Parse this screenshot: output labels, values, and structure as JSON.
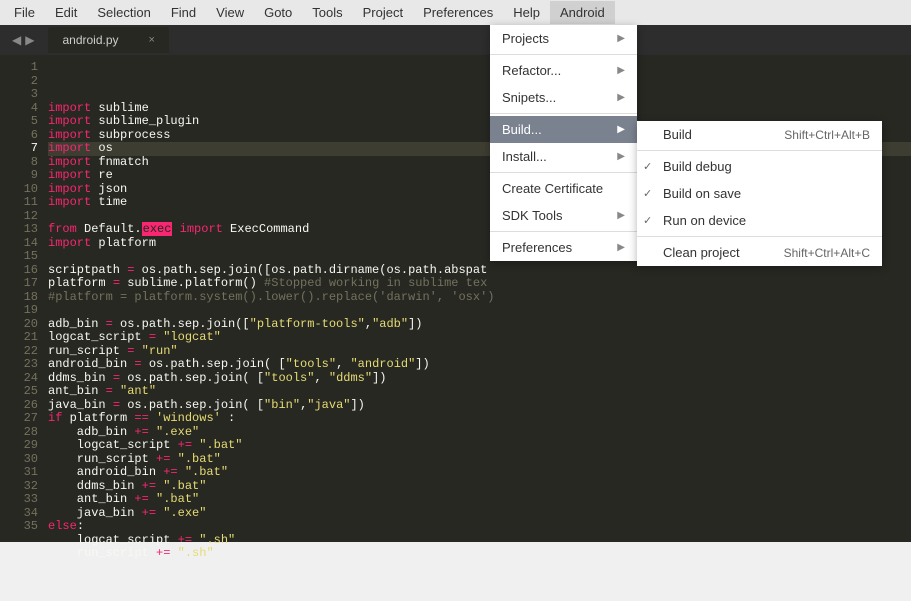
{
  "menubar": [
    "File",
    "Edit",
    "Selection",
    "Find",
    "View",
    "Goto",
    "Tools",
    "Project",
    "Preferences",
    "Help",
    "Android"
  ],
  "active_menu": "Android",
  "tab": {
    "name": "android.py"
  },
  "active_line": 7,
  "gutter_start": 1,
  "gutter_end": 35,
  "dropdown_main": [
    {
      "label": "Projects",
      "arrow": true
    },
    {
      "sep": true
    },
    {
      "label": "Refactor...",
      "arrow": true
    },
    {
      "label": "Snipets...",
      "arrow": true
    },
    {
      "sep": true
    },
    {
      "label": "Build...",
      "arrow": true,
      "hover": true
    },
    {
      "label": "Install...",
      "arrow": true
    },
    {
      "sep": true
    },
    {
      "label": "Create Certificate"
    },
    {
      "label": "SDK Tools",
      "arrow": true
    },
    {
      "sep": true
    },
    {
      "label": "Preferences",
      "arrow": true
    }
  ],
  "submenu": [
    {
      "label": "Build",
      "shortcut": "Shift+Ctrl+Alt+B"
    },
    {
      "sep": true
    },
    {
      "label": "Build debug",
      "check": true
    },
    {
      "label": "Build on save",
      "check": true
    },
    {
      "label": "Run on device",
      "check": true
    },
    {
      "sep": true
    },
    {
      "label": "Clean project",
      "shortcut": "Shift+Ctrl+Alt+C"
    }
  ],
  "code": [
    [
      [
        "kw",
        "import"
      ],
      [
        "id",
        " sublime"
      ]
    ],
    [
      [
        "kw",
        "import"
      ],
      [
        "id",
        " sublime_plugin"
      ]
    ],
    [
      [
        "kw",
        "import"
      ],
      [
        "id",
        " subprocess"
      ]
    ],
    [
      [
        "kw",
        "import"
      ],
      [
        "id",
        " os"
      ]
    ],
    [
      [
        "kw",
        "import"
      ],
      [
        "id",
        " fnmatch"
      ]
    ],
    [
      [
        "kw",
        "import"
      ],
      [
        "id",
        " re"
      ]
    ],
    [
      [
        "kw",
        "import"
      ],
      [
        "id",
        " json"
      ]
    ],
    [
      [
        "kw",
        "import"
      ],
      [
        "id",
        " time"
      ]
    ],
    [],
    [
      [
        "kw",
        "from"
      ],
      [
        "id",
        " Default."
      ],
      [
        "hl-exec",
        "exec"
      ],
      [
        "id",
        " "
      ],
      [
        "kw",
        "import"
      ],
      [
        "id",
        " ExecCommand"
      ]
    ],
    [
      [
        "kw",
        "import"
      ],
      [
        "id",
        " platform"
      ]
    ],
    [],
    [
      [
        "id",
        "scriptpath "
      ],
      [
        "kw",
        "="
      ],
      [
        "id",
        " os.path.sep.join([os.path.dirname(os.path.abspat"
      ]
    ],
    [
      [
        "id",
        "platform "
      ],
      [
        "kw",
        "="
      ],
      [
        "id",
        " sublime.platform() "
      ],
      [
        "cm",
        "#Stopped working in sublime tex"
      ]
    ],
    [
      [
        "cm",
        "#platform = platform.system().lower().replace('darwin', 'osx')"
      ]
    ],
    [],
    [
      [
        "id",
        "adb_bin "
      ],
      [
        "kw",
        "="
      ],
      [
        "id",
        " os.path.sep.join(["
      ],
      [
        "st",
        "\"platform-tools\""
      ],
      [
        "id",
        ","
      ],
      [
        "st",
        "\"adb\""
      ],
      [
        "id",
        "])"
      ]
    ],
    [
      [
        "id",
        "logcat_script "
      ],
      [
        "kw",
        "="
      ],
      [
        "id",
        " "
      ],
      [
        "st",
        "\"logcat\""
      ]
    ],
    [
      [
        "id",
        "run_script "
      ],
      [
        "kw",
        "="
      ],
      [
        "id",
        " "
      ],
      [
        "st",
        "\"run\""
      ]
    ],
    [
      [
        "id",
        "android_bin "
      ],
      [
        "kw",
        "="
      ],
      [
        "id",
        " os.path.sep.join( ["
      ],
      [
        "st",
        "\"tools\""
      ],
      [
        "id",
        ", "
      ],
      [
        "st",
        "\"android\""
      ],
      [
        "id",
        "])"
      ]
    ],
    [
      [
        "id",
        "ddms_bin "
      ],
      [
        "kw",
        "="
      ],
      [
        "id",
        " os.path.sep.join( ["
      ],
      [
        "st",
        "\"tools\""
      ],
      [
        "id",
        ", "
      ],
      [
        "st",
        "\"ddms\""
      ],
      [
        "id",
        "])"
      ]
    ],
    [
      [
        "id",
        "ant_bin "
      ],
      [
        "kw",
        "="
      ],
      [
        "id",
        " "
      ],
      [
        "st",
        "\"ant\""
      ]
    ],
    [
      [
        "id",
        "java_bin "
      ],
      [
        "kw",
        "="
      ],
      [
        "id",
        " os.path.sep.join( ["
      ],
      [
        "st",
        "\"bin\""
      ],
      [
        "id",
        ","
      ],
      [
        "st",
        "\"java\""
      ],
      [
        "id",
        "])"
      ]
    ],
    [
      [
        "kw",
        "if"
      ],
      [
        "id",
        " platform "
      ],
      [
        "kw",
        "=="
      ],
      [
        "id",
        " "
      ],
      [
        "st",
        "'windows'"
      ],
      [
        "id",
        " :"
      ]
    ],
    [
      [
        "id",
        "    adb_bin "
      ],
      [
        "kw",
        "+="
      ],
      [
        "id",
        " "
      ],
      [
        "st",
        "\".exe\""
      ]
    ],
    [
      [
        "id",
        "    logcat_script "
      ],
      [
        "kw",
        "+="
      ],
      [
        "id",
        " "
      ],
      [
        "st",
        "\".bat\""
      ]
    ],
    [
      [
        "id",
        "    run_script "
      ],
      [
        "kw",
        "+="
      ],
      [
        "id",
        " "
      ],
      [
        "st",
        "\".bat\""
      ]
    ],
    [
      [
        "id",
        "    android_bin "
      ],
      [
        "kw",
        "+="
      ],
      [
        "id",
        " "
      ],
      [
        "st",
        "\".bat\""
      ]
    ],
    [
      [
        "id",
        "    ddms_bin "
      ],
      [
        "kw",
        "+="
      ],
      [
        "id",
        " "
      ],
      [
        "st",
        "\".bat\""
      ]
    ],
    [
      [
        "id",
        "    ant_bin "
      ],
      [
        "kw",
        "+="
      ],
      [
        "id",
        " "
      ],
      [
        "st",
        "\".bat\""
      ]
    ],
    [
      [
        "id",
        "    java_bin "
      ],
      [
        "kw",
        "+="
      ],
      [
        "id",
        " "
      ],
      [
        "st",
        "\".exe\""
      ]
    ],
    [
      [
        "kw",
        "else"
      ],
      [
        "id",
        ":"
      ]
    ],
    [
      [
        "id",
        "    logcat_script "
      ],
      [
        "kw",
        "+="
      ],
      [
        "id",
        " "
      ],
      [
        "st",
        "\".sh\""
      ]
    ],
    [
      [
        "id",
        "    run_script "
      ],
      [
        "kw",
        "+="
      ],
      [
        "id",
        " "
      ],
      [
        "st",
        "\".sh\""
      ]
    ],
    []
  ]
}
